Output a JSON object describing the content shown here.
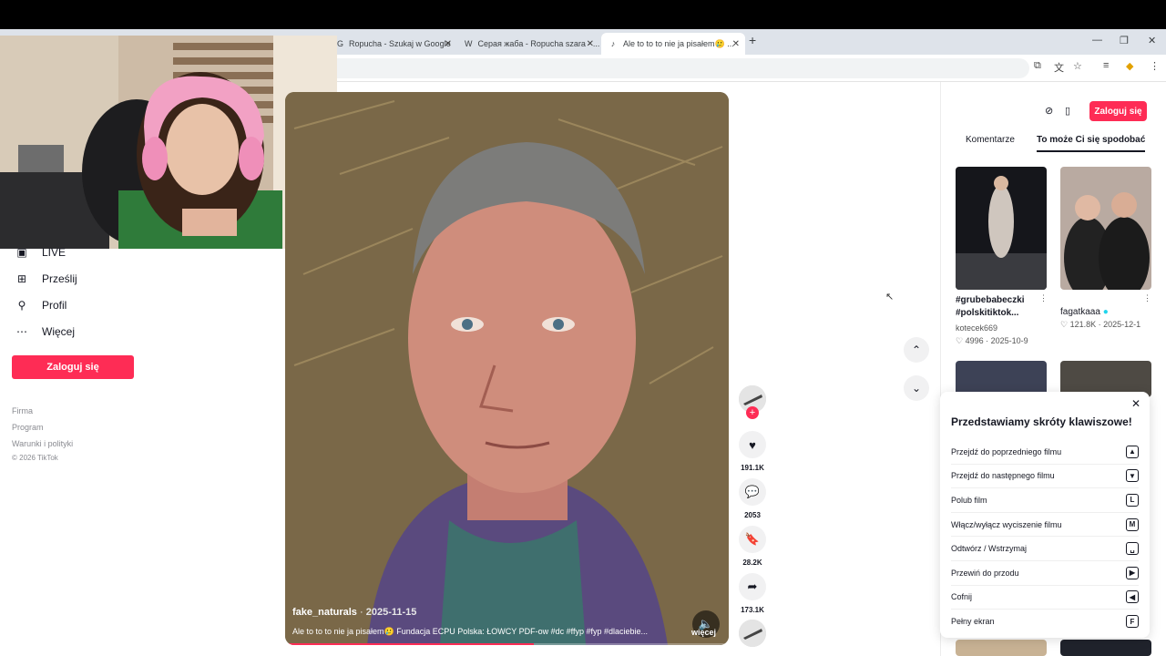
{
  "browser": {
    "tabs": [
      {
        "label": "Ropucha - Szukaj w Google",
        "icon": "google-icon"
      },
      {
        "label": "Серая жаба - Ropucha szara - ...",
        "icon": "wikipedia-icon"
      },
      {
        "label": "Ale to to to nie ja pisałem🥲 ...",
        "icon": "tiktok-icon"
      }
    ],
    "new_tab": "+"
  },
  "sidebar": {
    "items": [
      {
        "label": "LIVE",
        "icon": "live-icon"
      },
      {
        "label": "Prześlij",
        "icon": "upload-icon"
      },
      {
        "label": "Profil",
        "icon": "profile-icon"
      },
      {
        "label": "Więcej",
        "icon": "more-icon"
      }
    ],
    "login": "Zaloguj się",
    "footer": [
      "Firma",
      "Program",
      "Warunki i polityki",
      "© 2026 TikTok"
    ]
  },
  "video": {
    "author": "fake_naturals",
    "date": "2025-11-15",
    "description": "Ale to to to nie ja pisałem🥲 Fundacja ECPU Polska: ŁOWCY PDF-ow #dc #ffyp #fyp #dlaciebie...",
    "more": "więcej",
    "progress": 0.56
  },
  "actions": {
    "likes": "191.1K",
    "comments": "2053",
    "saves": "28.2K",
    "shares": "173.1K"
  },
  "right_panel": {
    "login": "Zaloguj się",
    "tabs": [
      "Komentarze",
      "To może Ci się spodobać"
    ],
    "active_tab": 1,
    "items": [
      {
        "title": "#grubebabeczki #polskitiktok...",
        "user": "kotecek669",
        "likes": "4996",
        "date": "2025-10-9"
      },
      {
        "title": "",
        "user": "fagatkaaa",
        "likes": "121.8K",
        "date": "2025-12-1",
        "verified": true
      }
    ]
  },
  "shortcuts": {
    "title": "Przedstawiamy skróty klawiszowe!",
    "rows": [
      {
        "label": "Przejdź do poprzedniego filmu",
        "key": "▲"
      },
      {
        "label": "Przejdź do następnego filmu",
        "key": "▼"
      },
      {
        "label": "Polub film",
        "key": "L"
      },
      {
        "label": "Włącz/wyłącz wyciszenie filmu",
        "key": "M"
      },
      {
        "label": "Odtwórz / Wstrzymaj",
        "key": "␣"
      },
      {
        "label": "Przewiń do przodu",
        "key": "▶"
      },
      {
        "label": "Cofnij",
        "key": "◀"
      },
      {
        "label": "Pełny ekran",
        "key": "F"
      }
    ]
  },
  "colors": {
    "accent": "#fe2c55",
    "chrome_tabs": "#dee3ea"
  }
}
